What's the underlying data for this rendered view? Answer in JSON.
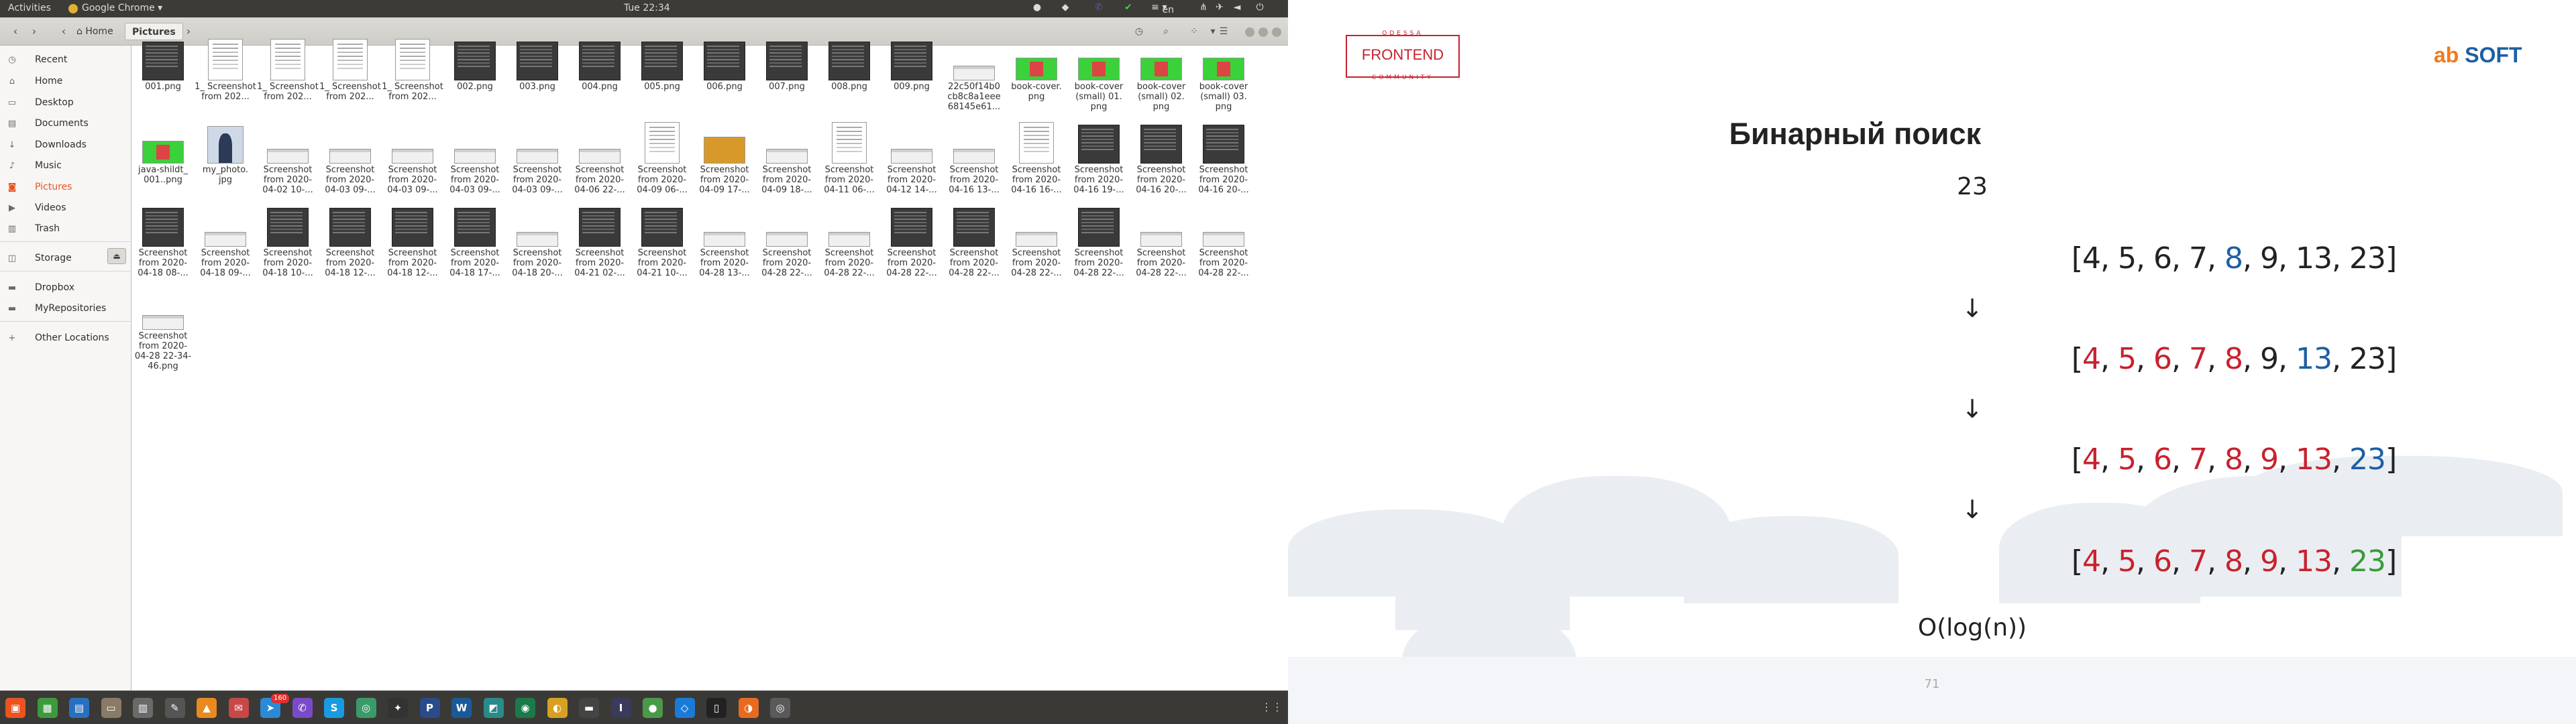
{
  "topbar": {
    "activities": "Activities",
    "app_name": "Google Chrome",
    "clock": "Tue 22:34",
    "lang": "en"
  },
  "nautilus": {
    "breadcrumb": [
      "Home",
      "Pictures"
    ],
    "sidebar": [
      {
        "label": "Recent",
        "icon": "clock-icon"
      },
      {
        "label": "Home",
        "icon": "home-icon"
      },
      {
        "label": "Desktop",
        "icon": "desktop-icon"
      },
      {
        "label": "Documents",
        "icon": "document-icon"
      },
      {
        "label": "Downloads",
        "icon": "download-icon"
      },
      {
        "label": "Music",
        "icon": "music-icon"
      },
      {
        "label": "Pictures",
        "icon": "camera-icon",
        "active": true
      },
      {
        "label": "Videos",
        "icon": "video-icon"
      },
      {
        "label": "Trash",
        "icon": "trash-icon"
      },
      {
        "label": "Storage",
        "icon": "drive-icon"
      },
      {
        "label": "Dropbox",
        "icon": "folder-icon"
      },
      {
        "label": "MyRepositories",
        "icon": "folder-icon"
      },
      {
        "label": "Other Locations",
        "icon": "plus-icon"
      }
    ],
    "files": [
      {
        "name": "001.png",
        "kind": "dark"
      },
      {
        "name": "1_ Screenshot from 202...",
        "kind": "doc"
      },
      {
        "name": "1_ Screenshot from 202...",
        "kind": "doc"
      },
      {
        "name": "1_ Screenshot from 202...",
        "kind": "doc"
      },
      {
        "name": "1_ Screenshot from 202...",
        "kind": "doc"
      },
      {
        "name": "002.png",
        "kind": "dark"
      },
      {
        "name": "003.png",
        "kind": "dark"
      },
      {
        "name": "004.png",
        "kind": "dark"
      },
      {
        "name": "005.png",
        "kind": "dark"
      },
      {
        "name": "006.png",
        "kind": "dark"
      },
      {
        "name": "007.png",
        "kind": "dark"
      },
      {
        "name": "008.png",
        "kind": "dark"
      },
      {
        "name": "009.png",
        "kind": "dark"
      },
      {
        "name": "22c50f14b0 cb8c8a1eee 68145e61...",
        "kind": "shot"
      },
      {
        "name": "book-cover. png",
        "kind": "green"
      },
      {
        "name": "book-cover (small) 01. png",
        "kind": "green"
      },
      {
        "name": "book-cover (small) 02. png",
        "kind": "green"
      },
      {
        "name": "book-cover (small) 03. png",
        "kind": "green"
      },
      {
        "name": "java-shildt_ 001..png",
        "kind": "green"
      },
      {
        "name": "my_photo. jpg",
        "kind": "photo"
      },
      {
        "name": "Screenshot from 2020-04-02 10-...",
        "kind": "shot"
      },
      {
        "name": "Screenshot from 2020-04-03 09-...",
        "kind": "shot"
      },
      {
        "name": "Screenshot from 2020-04-03 09-...",
        "kind": "shot"
      },
      {
        "name": "Screenshot from 2020-04-03 09-...",
        "kind": "shot"
      },
      {
        "name": "Screenshot from 2020-04-03 09-...",
        "kind": "shot"
      },
      {
        "name": "Screenshot from 2020-04-06 22-...",
        "kind": "shot"
      },
      {
        "name": "Screenshot from 2020-04-09 06-...",
        "kind": "doc"
      },
      {
        "name": "Screenshot from 2020-04-09 17-...",
        "kind": "orange"
      },
      {
        "name": "Screenshot from 2020-04-09 18-...",
        "kind": "shot"
      },
      {
        "name": "Screenshot from 2020-04-11 06-...",
        "kind": "doc"
      },
      {
        "name": "Screenshot from 2020-04-12 14-...",
        "kind": "shot"
      },
      {
        "name": "Screenshot from 2020-04-16 13-...",
        "kind": "shot"
      },
      {
        "name": "Screenshot from 2020-04-16 16-...",
        "kind": "doc"
      },
      {
        "name": "Screenshot from 2020-04-16 19-...",
        "kind": "dark"
      },
      {
        "name": "Screenshot from 2020-04-16 20-...",
        "kind": "dark"
      },
      {
        "name": "Screenshot from 2020-04-16 20-...",
        "kind": "dark"
      },
      {
        "name": "Screenshot from 2020-04-18 08-...",
        "kind": "dark"
      },
      {
        "name": "Screenshot from 2020-04-18 09-...",
        "kind": "shot"
      },
      {
        "name": "Screenshot from 2020-04-18 10-...",
        "kind": "dark"
      },
      {
        "name": "Screenshot from 2020-04-18 12-...",
        "kind": "dark"
      },
      {
        "name": "Screenshot from 2020-04-18 12-...",
        "kind": "dark"
      },
      {
        "name": "Screenshot from 2020-04-18 17-...",
        "kind": "dark"
      },
      {
        "name": "Screenshot from 2020-04-18 20-...",
        "kind": "shot"
      },
      {
        "name": "Screenshot from 2020-04-21 02-...",
        "kind": "dark"
      },
      {
        "name": "Screenshot from 2020-04-21 10-...",
        "kind": "dark"
      },
      {
        "name": "Screenshot from 2020-04-28 13-...",
        "kind": "shot"
      },
      {
        "name": "Screenshot from 2020-04-28 22-...",
        "kind": "shot"
      },
      {
        "name": "Screenshot from 2020-04-28 22-...",
        "kind": "shot"
      },
      {
        "name": "Screenshot from 2020-04-28 22-...",
        "kind": "dark"
      },
      {
        "name": "Screenshot from 2020-04-28 22-...",
        "kind": "dark"
      },
      {
        "name": "Screenshot from 2020-04-28 22-...",
        "kind": "shot"
      },
      {
        "name": "Screenshot from 2020-04-28 22-...",
        "kind": "dark"
      },
      {
        "name": "Screenshot from 2020-04-28 22-...",
        "kind": "shot"
      },
      {
        "name": "Screenshot from 2020-04-28 22-...",
        "kind": "shot"
      },
      {
        "name": "Screenshot from 2020-04-28 22-34-46.png",
        "kind": "shot"
      }
    ]
  },
  "taskbar": {
    "apps": [
      {
        "icon": "files-orange-icon",
        "color": "#e95420",
        "glyph": "▣"
      },
      {
        "icon": "spreadsheet-icon",
        "color": "#3c9a3c",
        "glyph": "▦"
      },
      {
        "icon": "document-writer-icon",
        "color": "#2a6fbf",
        "glyph": "▤"
      },
      {
        "icon": "file-manager-icon",
        "color": "#8a7a66",
        "glyph": "▭"
      },
      {
        "icon": "archive-icon",
        "color": "#6a6a6a",
        "glyph": "▥"
      },
      {
        "icon": "screwdriver-icon",
        "color": "#555555",
        "glyph": "✎"
      },
      {
        "icon": "vlc-icon",
        "color": "#e98a20",
        "glyph": "▲"
      },
      {
        "icon": "mail-icon",
        "color": "#c84848",
        "glyph": "✉"
      },
      {
        "icon": "telegram-icon",
        "color": "#2a8ad8",
        "glyph": "➤"
      },
      {
        "icon": "viber-icon",
        "color": "#7a4ac8",
        "glyph": "✆"
      },
      {
        "icon": "skype-icon",
        "color": "#1a9ae0",
        "glyph": "S"
      },
      {
        "icon": "chrome-icon",
        "color": "#3a9a6a",
        "glyph": "◎"
      },
      {
        "icon": "inkscape-icon",
        "color": "#333333",
        "glyph": "✦"
      },
      {
        "icon": "pycharm-icon",
        "color": "#2a4a8a",
        "glyph": "P"
      },
      {
        "icon": "webstorm-icon",
        "color": "#1a5a9a",
        "glyph": "W"
      },
      {
        "icon": "image-viewer-icon",
        "color": "#2a8a8a",
        "glyph": "◩"
      },
      {
        "icon": "gitkraken-icon",
        "color": "#1a7a4a",
        "glyph": "◉"
      },
      {
        "icon": "idea-icon",
        "color": "#d8a020",
        "glyph": "◐"
      },
      {
        "icon": "terminal-icon",
        "color": "#444444",
        "glyph": "▬"
      },
      {
        "icon": "intellij-icon",
        "color": "#3a3a5a",
        "glyph": "I"
      },
      {
        "icon": "android-icon",
        "color": "#4a9a4a",
        "glyph": "●"
      },
      {
        "icon": "vscode-icon",
        "color": "#1a7ad8",
        "glyph": "◇"
      },
      {
        "icon": "console-icon",
        "color": "#222222",
        "glyph": "▯"
      },
      {
        "icon": "postman-icon",
        "color": "#e86a20",
        "glyph": "◑"
      },
      {
        "icon": "chrome-active-icon",
        "color": "#5a5a5a",
        "glyph": "◎"
      }
    ],
    "badge": "160"
  },
  "slide": {
    "logo_left_top": "ODESSA",
    "logo_left_main": "FRONTEND",
    "logo_left_bottom": "COMMUNITY",
    "logo_right_ab": "ab",
    "logo_right_soft": " SOFT",
    "title": "Бинарный поиск",
    "target": "23",
    "rows": [
      [
        {
          "v": "4",
          "c": "k"
        },
        {
          "v": "5",
          "c": "k"
        },
        {
          "v": "6",
          "c": "k"
        },
        {
          "v": "7",
          "c": "k"
        },
        {
          "v": "8",
          "c": "b"
        },
        {
          "v": "9",
          "c": "k"
        },
        {
          "v": "13",
          "c": "k"
        },
        {
          "v": "23",
          "c": "k"
        }
      ],
      [
        {
          "v": "4",
          "c": "r"
        },
        {
          "v": "5",
          "c": "r"
        },
        {
          "v": "6",
          "c": "r"
        },
        {
          "v": "7",
          "c": "r"
        },
        {
          "v": "8",
          "c": "r"
        },
        {
          "v": "9",
          "c": "k"
        },
        {
          "v": "13",
          "c": "b"
        },
        {
          "v": "23",
          "c": "k"
        }
      ],
      [
        {
          "v": "4",
          "c": "r"
        },
        {
          "v": "5",
          "c": "r"
        },
        {
          "v": "6",
          "c": "r"
        },
        {
          "v": "7",
          "c": "r"
        },
        {
          "v": "8",
          "c": "r"
        },
        {
          "v": "9",
          "c": "r"
        },
        {
          "v": "13",
          "c": "r"
        },
        {
          "v": "23",
          "c": "b"
        }
      ],
      [
        {
          "v": "4",
          "c": "r"
        },
        {
          "v": "5",
          "c": "r"
        },
        {
          "v": "6",
          "c": "r"
        },
        {
          "v": "7",
          "c": "r"
        },
        {
          "v": "8",
          "c": "r"
        },
        {
          "v": "9",
          "c": "r"
        },
        {
          "v": "13",
          "c": "r"
        },
        {
          "v": "23",
          "c": "g"
        }
      ]
    ],
    "arrow": "↓",
    "complexity": "O(log(n))",
    "page_number": "71"
  }
}
